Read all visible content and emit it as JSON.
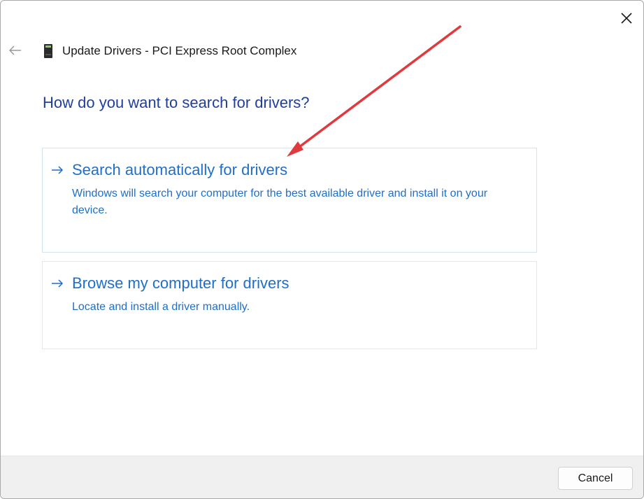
{
  "window": {
    "title": "Update Drivers - PCI Express Root Complex",
    "close_icon": "close-icon",
    "back_icon": "back-arrow-icon",
    "device_icon": "device-icon"
  },
  "main": {
    "heading": "How do you want to search for drivers?",
    "options": [
      {
        "title": "Search automatically for drivers",
        "description": "Windows will search your computer for the best available driver and install it on your device.",
        "icon": "arrow-right-icon"
      },
      {
        "title": "Browse my computer for drivers",
        "description": "Locate and install a driver manually.",
        "icon": "arrow-right-icon"
      }
    ]
  },
  "footer": {
    "cancel_label": "Cancel"
  },
  "colors": {
    "heading": "#1f3f9c",
    "link": "#1f6fc9",
    "annotation": "#e0393e",
    "footer_bg": "#f0f0f0"
  }
}
